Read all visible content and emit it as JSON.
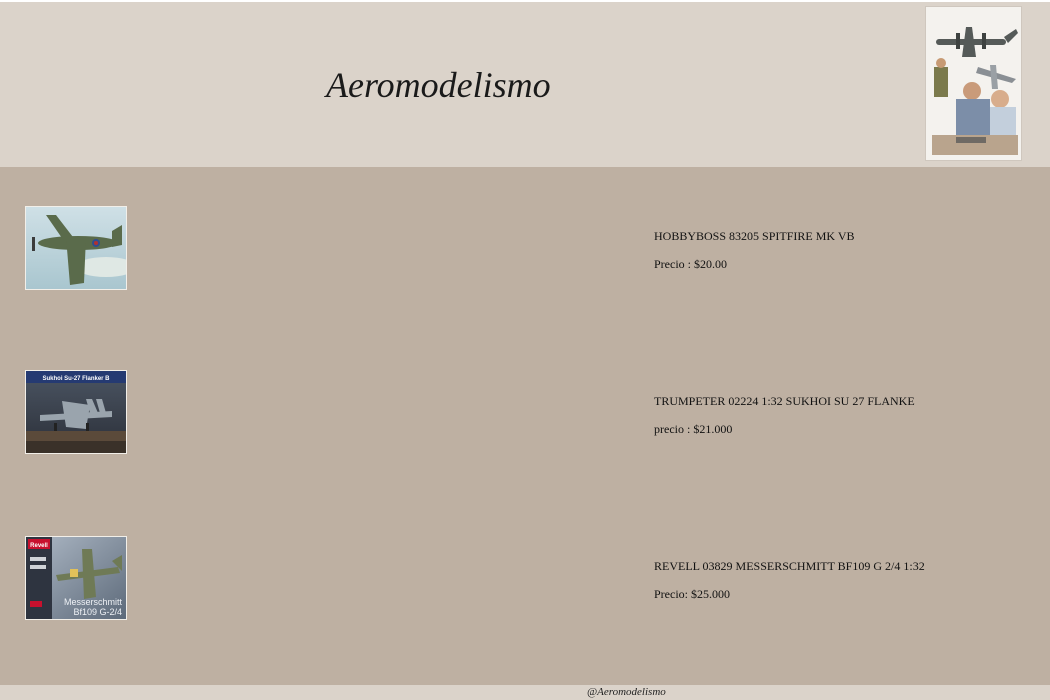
{
  "header": {
    "title": "Aeromodelismo",
    "image": "family-building-model-planes-photo"
  },
  "products": [
    {
      "name": "HOBBYBOSS 83205 SPITFIRE MK VB",
      "price": "Precio : $20.00",
      "image": "spitfire-box-art"
    },
    {
      "name": "TRUMPETER 02224 1:32 SUKHOI SU 27 FLANKE",
      "price": "precio : $21.000",
      "image": "sukhoi-box-art",
      "box_banner": "Sukhoi Su-27 Flanker B"
    },
    {
      "name": "REVELL 03829 MESSERSCHMITT BF109 G 2/4 1:32",
      "price": "Precio: $25.000",
      "image": "messerschmitt-box-art",
      "box_brand": "Revell",
      "box_text": "Messerschmitt",
      "box_text2": "Bf109 G-2/4"
    }
  ],
  "footer": {
    "text": "@Aeromodelismo"
  },
  "colors": {
    "header_bg": "#dbd3ca",
    "main_bg": "#beb0a2",
    "footer_bg": "#dbd3ca"
  }
}
